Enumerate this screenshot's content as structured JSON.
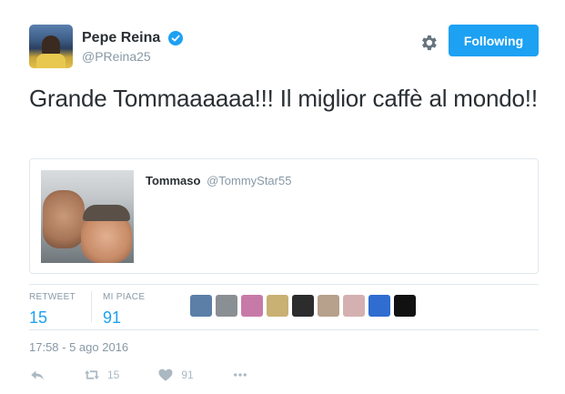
{
  "author": {
    "name": "Pepe Reina",
    "handle": "@PReina25",
    "verified": true
  },
  "follow_button": {
    "label": "Following"
  },
  "tweet": {
    "text": "Grande Tommaaaaaa!!! Il miglior caffè al mondo!!"
  },
  "quoted_tweet": {
    "name": "Tommaso",
    "handle": "@TommyStar55"
  },
  "stats": {
    "retweet_label": "RETWEET",
    "retweet_count": "15",
    "like_label": "MI PIACE",
    "like_count": "91"
  },
  "likers": [
    {
      "color": "#5b7fa6"
    },
    {
      "color": "#8a8f94"
    },
    {
      "color": "#c77aa8"
    },
    {
      "color": "#c9b073"
    },
    {
      "color": "#2c2c2c"
    },
    {
      "color": "#b7a08c"
    },
    {
      "color": "#d4b0b0"
    },
    {
      "color": "#2f6dd0"
    },
    {
      "color": "#111111"
    }
  ],
  "timestamp": "17:58 - 5 ago 2016",
  "actions": {
    "reply_icon": "reply-icon",
    "retweet_icon": "retweet-icon",
    "retweet_count": "15",
    "like_icon": "heart-icon",
    "like_count": "91",
    "more_icon": "more-icon"
  },
  "colors": {
    "accent": "#1da1f2",
    "muted": "#8899a6",
    "text": "#292f33",
    "border": "#e1e8ed"
  }
}
